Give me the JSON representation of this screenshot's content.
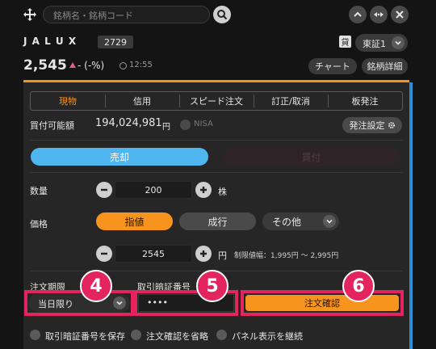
{
  "header": {
    "search_placeholder": "銘柄名・銘柄コード",
    "stock_name": "J A L U X",
    "stock_code": "2729",
    "market_badge": "貸",
    "market": "東証1",
    "price": "2,545",
    "change": "- (-%)",
    "time": "12:55",
    "chart_label": "チャート",
    "details_label": "銘柄詳細"
  },
  "tabs": [
    "現物",
    "信用",
    "スピード注文",
    "訂正/取消",
    "板発注"
  ],
  "account": {
    "buying_power_label": "買付可能額",
    "buying_power_value": "194,024,981",
    "buying_power_unit": "円",
    "nisa_label": "NISA",
    "order_settings_label": "発注設定"
  },
  "side": {
    "sell_label": "売却",
    "buy_label": "買付"
  },
  "quantity": {
    "label": "数量",
    "value": "200",
    "unit": "株"
  },
  "price_section": {
    "label": "価格",
    "limit_label": "指値",
    "market_label": "成行",
    "other_label": "その他",
    "price_value": "2545",
    "price_unit": "円",
    "limit_range": "制限値幅：1,995円 ～ 2,995円"
  },
  "order": {
    "expiry_label": "注文期限",
    "expiry_value": "当日限り",
    "pin_label": "取引暗証番号",
    "pin_value": "••••",
    "confirm_label": "注文確認"
  },
  "options": [
    "取引暗証番号を保存",
    "注文確認を省略",
    "パネル表示を継続"
  ],
  "annotations": [
    "4",
    "5",
    "6"
  ],
  "colors": {
    "accent": "#f7941d",
    "sell": "#4fb6f0",
    "highlight": "#e4245e"
  },
  "icons": [
    "move-icon",
    "search-icon",
    "chevron-up-icon",
    "swap-icon",
    "close-icon",
    "chevron-down-icon",
    "clock-icon",
    "gear-icon",
    "minus-icon",
    "plus-icon"
  ]
}
